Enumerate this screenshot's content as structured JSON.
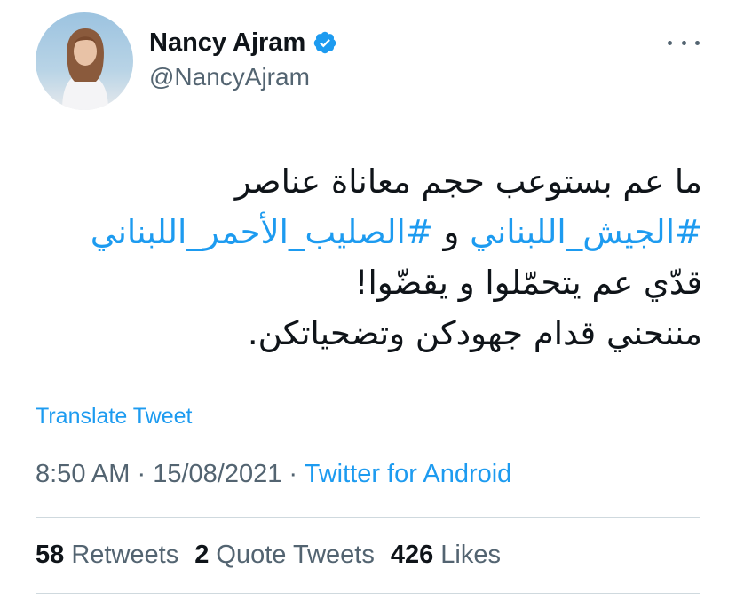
{
  "author": {
    "display_name": "Nancy Ajram",
    "handle": "@NancyAjram",
    "verified": true,
    "avatar_icon": "profile-photo",
    "verified_icon": "verified-badge-icon",
    "more_icon": "more-options-icon"
  },
  "tweet": {
    "line1": "ما عم بستوعب حجم معاناة عناصر",
    "hashtag1": "#الجيش_اللبناني",
    "connector": " و ",
    "hashtag2": "#الصليب_الأحمر_اللبناني",
    "line3": "قدّي عم يتحمّلوا و يقضّوا!",
    "line4": "مننحني قدام جهودكن وتضحياتكن."
  },
  "translate_label": "Translate Tweet",
  "meta": {
    "time": "8:50 AM",
    "separator": " · ",
    "date": "15/08/2021",
    "source": "Twitter for Android"
  },
  "stats": {
    "retweets_count": "58",
    "retweets_label": "Retweets",
    "quotes_count": "2",
    "quotes_label": "Quote Tweets",
    "likes_count": "426",
    "likes_label": "Likes"
  },
  "colors": {
    "accent": "#1d9bf0",
    "text_primary": "#0f1419",
    "text_secondary": "#536471",
    "divider": "#cfd9de"
  }
}
